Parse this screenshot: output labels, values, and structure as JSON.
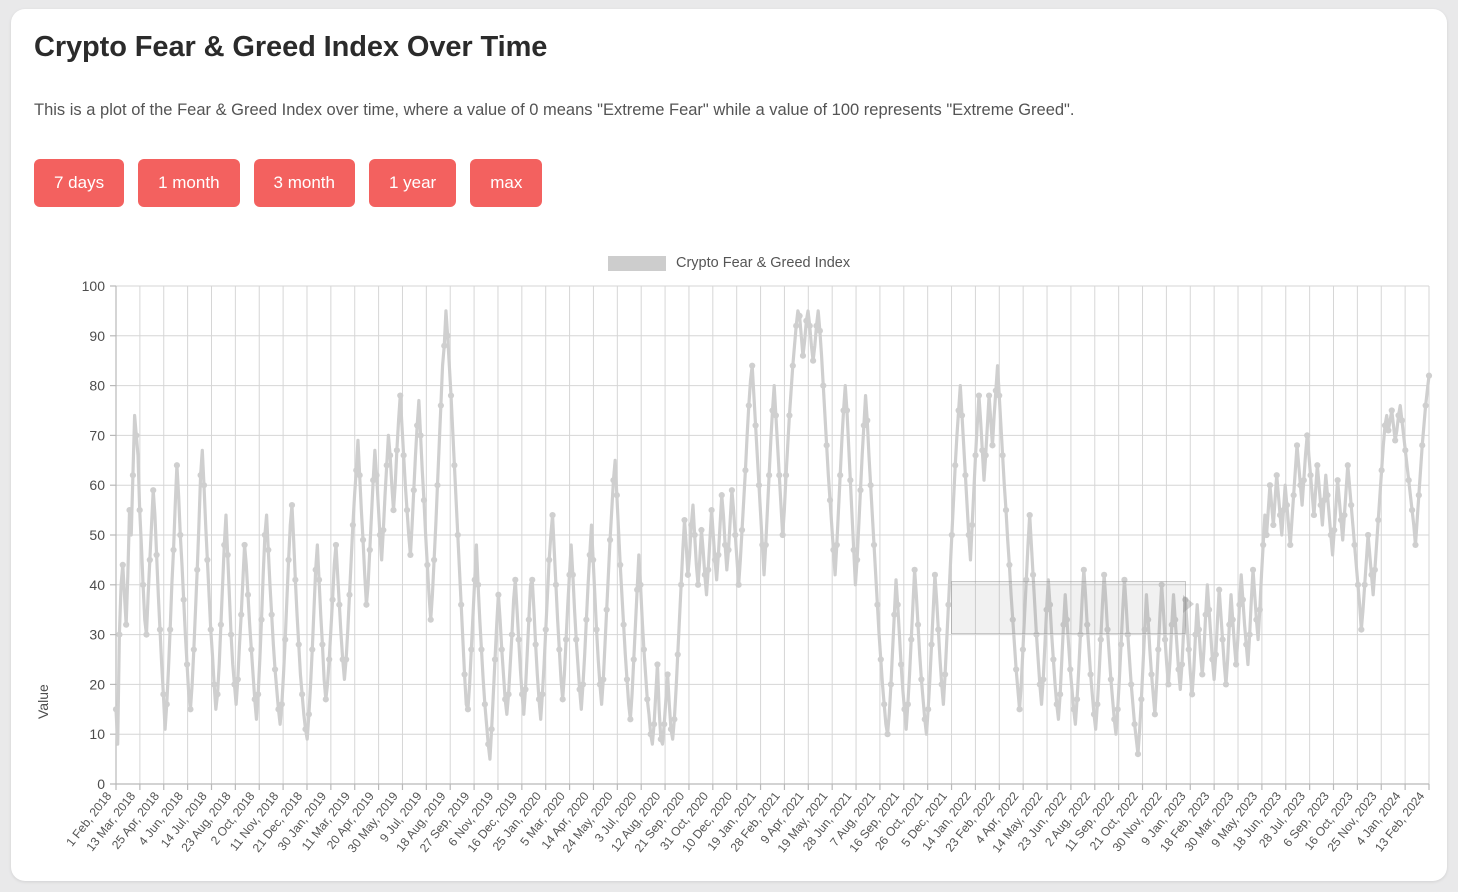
{
  "page": {
    "title": "Crypto Fear & Greed Index Over Time",
    "description": "This is a plot of the Fear & Greed Index over time, where a value of 0 means \"Extreme Fear\" while a value of 100 represents \"Extreme Greed\".",
    "background_color": "#e9e9ea",
    "card_color": "#ffffff"
  },
  "range_buttons": [
    {
      "label": "7 days",
      "id": "range-7-days"
    },
    {
      "label": "1 month",
      "id": "range-1-month"
    },
    {
      "label": "3 month",
      "id": "range-3-month"
    },
    {
      "label": "1 year",
      "id": "range-1-year"
    },
    {
      "label": "max",
      "id": "range-max"
    }
  ],
  "button_color": "#f3615f",
  "chart_data": {
    "type": "line",
    "title": "",
    "xlabel": "",
    "ylabel": "Value",
    "ylim": [
      0,
      100
    ],
    "yticks": [
      0,
      10,
      20,
      30,
      40,
      50,
      60,
      70,
      80,
      90,
      100
    ],
    "grid": true,
    "legend": {
      "position": "top-center",
      "entries": [
        {
          "name": "Crypto Fear & Greed Index",
          "color": "#cdcdcd"
        }
      ]
    },
    "series_color": "#cfcfcf",
    "marker": "circle",
    "xtick_labels": [
      "1 Feb, 2018",
      "13 Mar, 2018",
      "25 Apr, 2018",
      "4 Jun, 2018",
      "14 Jul, 2018",
      "23 Aug, 2018",
      "2 Oct, 2018",
      "11 Nov, 2018",
      "21 Dec, 2018",
      "30 Jan, 2019",
      "11 Mar, 2019",
      "20 Apr, 2019",
      "30 May, 2019",
      "9 Jul, 2019",
      "18 Aug, 2019",
      "27 Sep, 2019",
      "6 Nov, 2019",
      "16 Dec, 2019",
      "25 Jan, 2020",
      "5 Mar, 2020",
      "14 Apr, 2020",
      "24 May, 2020",
      "3 Jul, 2020",
      "12 Aug, 2020",
      "21 Sep, 2020",
      "31 Oct, 2020",
      "10 Dec, 2020",
      "19 Jan, 2021",
      "28 Feb, 2021",
      "9 Apr, 2021",
      "19 May, 2021",
      "28 Jun, 2021",
      "7 Aug, 2021",
      "16 Sep, 2021",
      "26 Oct, 2021",
      "5 Dec, 2021",
      "14 Jan, 2022",
      "23 Feb, 2022",
      "4 Apr, 2022",
      "14 May, 2022",
      "23 Jun, 2022",
      "2 Aug, 2022",
      "11 Sep, 2022",
      "21 Oct, 2022",
      "30 Nov, 2022",
      "9 Jan, 2023",
      "18 Feb, 2023",
      "30 Mar, 2023",
      "9 May, 2023",
      "18 Jun, 2023",
      "28 Jul, 2023",
      "6 Sep, 2023",
      "16 Oct, 2023",
      "25 Nov, 2023",
      "4 Jan, 2024",
      "13 Feb, 2024"
    ],
    "x_start": "1 Feb, 2018",
    "x_end": "13 Feb, 2024",
    "series": [
      {
        "name": "Crypto Fear & Greed Index",
        "values": [
          15,
          8,
          30,
          40,
          44,
          38,
          32,
          42,
          55,
          50,
          62,
          74,
          70,
          66,
          55,
          48,
          40,
          33,
          30,
          38,
          45,
          52,
          59,
          54,
          46,
          38,
          31,
          24,
          18,
          11,
          16,
          23,
          31,
          40,
          47,
          56,
          64,
          58,
          50,
          44,
          37,
          30,
          24,
          18,
          15,
          20,
          27,
          35,
          43,
          52,
          62,
          67,
          60,
          52,
          45,
          38,
          31,
          26,
          20,
          15,
          18,
          24,
          32,
          40,
          48,
          54,
          46,
          38,
          30,
          24,
          20,
          16,
          21,
          28,
          34,
          41,
          48,
          44,
          38,
          32,
          27,
          22,
          17,
          13,
          18,
          25,
          33,
          42,
          50,
          54,
          47,
          40,
          34,
          28,
          23,
          19,
          15,
          12,
          16,
          22,
          29,
          37,
          45,
          52,
          56,
          49,
          41,
          34,
          28,
          22,
          18,
          14,
          11,
          9,
          14,
          20,
          27,
          35,
          43,
          48,
          41,
          34,
          28,
          21,
          17,
          20,
          25,
          31,
          37,
          44,
          48,
          42,
          36,
          30,
          25,
          21,
          25,
          31,
          38,
          45,
          52,
          58,
          63,
          69,
          62,
          55,
          49,
          42,
          36,
          40,
          47,
          54,
          61,
          67,
          62,
          56,
          50,
          45,
          51,
          58,
          64,
          70,
          66,
          60,
          55,
          60,
          67,
          73,
          78,
          72,
          66,
          60,
          55,
          50,
          46,
          52,
          59,
          66,
          72,
          77,
          70,
          63,
          57,
          50,
          44,
          38,
          33,
          38,
          45,
          52,
          60,
          68,
          76,
          84,
          88,
          95,
          90,
          84,
          78,
          71,
          64,
          57,
          50,
          43,
          36,
          29,
          22,
          16,
          15,
          20,
          27,
          34,
          41,
          48,
          40,
          33,
          27,
          21,
          16,
          12,
          8,
          5,
          11,
          18,
          25,
          32,
          38,
          33,
          27,
          22,
          17,
          14,
          18,
          24,
          30,
          37,
          41,
          35,
          29,
          23,
          18,
          14,
          19,
          26,
          33,
          40,
          41,
          35,
          28,
          22,
          17,
          13,
          18,
          24,
          31,
          38,
          45,
          50,
          54,
          47,
          40,
          33,
          27,
          21,
          17,
          22,
          29,
          36,
          42,
          48,
          42,
          35,
          29,
          24,
          19,
          15,
          20,
          26,
          33,
          40,
          46,
          52,
          45,
          38,
          31,
          25,
          20,
          16,
          21,
          28,
          35,
          42,
          49,
          55,
          61,
          65,
          58,
          51,
          44,
          38,
          32,
          26,
          21,
          16,
          13,
          18,
          25,
          32,
          39,
          46,
          40,
          33,
          27,
          22,
          17,
          14,
          10,
          8,
          12,
          18,
          24,
          15,
          9,
          8,
          12,
          17,
          22,
          16,
          11,
          9,
          13,
          19,
          26,
          33,
          40,
          47,
          53,
          48,
          42,
          46,
          52,
          56,
          50,
          44,
          40,
          45,
          51,
          47,
          42,
          38,
          43,
          49,
          55,
          50,
          45,
          41,
          46,
          52,
          58,
          54,
          48,
          43,
          47,
          53,
          59,
          55,
          50,
          45,
          40,
          45,
          51,
          57,
          63,
          70,
          76,
          81,
          84,
          78,
          72,
          66,
          60,
          54,
          48,
          42,
          48,
          55,
          62,
          69,
          75,
          80,
          74,
          68,
          62,
          56,
          50,
          55,
          62,
          68,
          74,
          79,
          84,
          88,
          92,
          95,
          94,
          90,
          86,
          89,
          93,
          95,
          92,
          88,
          85,
          88,
          92,
          95,
          91,
          86,
          80,
          74,
          68,
          62,
          57,
          52,
          47,
          42,
          48,
          55,
          62,
          69,
          75,
          80,
          75,
          68,
          61,
          54,
          47,
          40,
          45,
          52,
          59,
          66,
          72,
          78,
          73,
          66,
          60,
          54,
          48,
          42,
          36,
          30,
          25,
          20,
          16,
          12,
          10,
          14,
          20,
          27,
          34,
          41,
          36,
          30,
          24,
          19,
          15,
          11,
          16,
          22,
          29,
          36,
          43,
          38,
          32,
          26,
          21,
          17,
          13,
          10,
          15,
          21,
          28,
          35,
          42,
          37,
          31,
          25,
          20,
          16,
          22,
          29,
          36,
          43,
          50,
          57,
          64,
          70,
          75,
          80,
          74,
          68,
          62,
          56,
          50,
          45,
          52,
          59,
          66,
          72,
          78,
          73,
          67,
          61,
          66,
          72,
          78,
          73,
          68,
          74,
          79,
          84,
          78,
          72,
          66,
          60,
          55,
          49,
          44,
          38,
          33,
          28,
          23,
          19,
          15,
          20,
          27,
          34,
          41,
          48,
          54,
          48,
          42,
          36,
          30,
          25,
          20,
          16,
          21,
          28,
          35,
          41,
          36,
          30,
          25,
          20,
          16,
          13,
          18,
          25,
          32,
          38,
          33,
          28,
          23,
          19,
          15,
          12,
          17,
          23,
          30,
          37,
          43,
          38,
          32,
          27,
          22,
          18,
          14,
          11,
          16,
          22,
          29,
          36,
          42,
          37,
          31,
          26,
          21,
          17,
          13,
          10,
          15,
          21,
          28,
          35,
          41,
          36,
          30,
          25,
          20,
          16,
          12,
          9,
          6,
          11,
          17,
          24,
          31,
          38,
          33,
          27,
          22,
          18,
          14,
          20,
          27,
          34,
          40,
          35,
          29,
          24,
          20,
          25,
          32,
          38,
          33,
          28,
          23,
          19,
          24,
          31,
          37,
          32,
          27,
          22,
          18,
          23,
          30,
          36,
          31,
          26,
          22,
          27,
          34,
          40,
          35,
          30,
          25,
          21,
          26,
          33,
          39,
          34,
          29,
          24,
          20,
          25,
          32,
          38,
          33,
          28,
          24,
          29,
          36,
          42,
          37,
          32,
          28,
          24,
          30,
          37,
          43,
          38,
          33,
          29,
          35,
          42,
          48,
          54,
          50,
          55,
          60,
          56,
          52,
          57,
          62,
          58,
          54,
          50,
          55,
          60,
          56,
          52,
          48,
          53,
          58,
          63,
          68,
          64,
          60,
          56,
          61,
          66,
          70,
          66,
          62,
          58,
          54,
          59,
          64,
          60,
          56,
          52,
          57,
          62,
          58,
          54,
          50,
          46,
          51,
          56,
          61,
          57,
          53,
          49,
          54,
          59,
          64,
          60,
          56,
          52,
          48,
          44,
          40,
          36,
          31,
          35,
          40,
          45,
          50,
          46,
          42,
          38,
          43,
          48,
          53,
          58,
          63,
          68,
          72,
          74,
          71,
          73,
          75,
          72,
          69,
          71,
          74,
          76,
          73,
          70,
          67,
          64,
          61,
          58,
          55,
          52,
          48,
          53,
          58,
          63,
          68,
          72,
          76,
          79,
          82
        ]
      }
    ],
    "annotations": {
      "selection_box": {
        "present": true,
        "value_range": [
          30,
          41
        ],
        "x_range": [
          "14 May, 2022",
          "18 Feb, 2023"
        ]
      }
    }
  }
}
